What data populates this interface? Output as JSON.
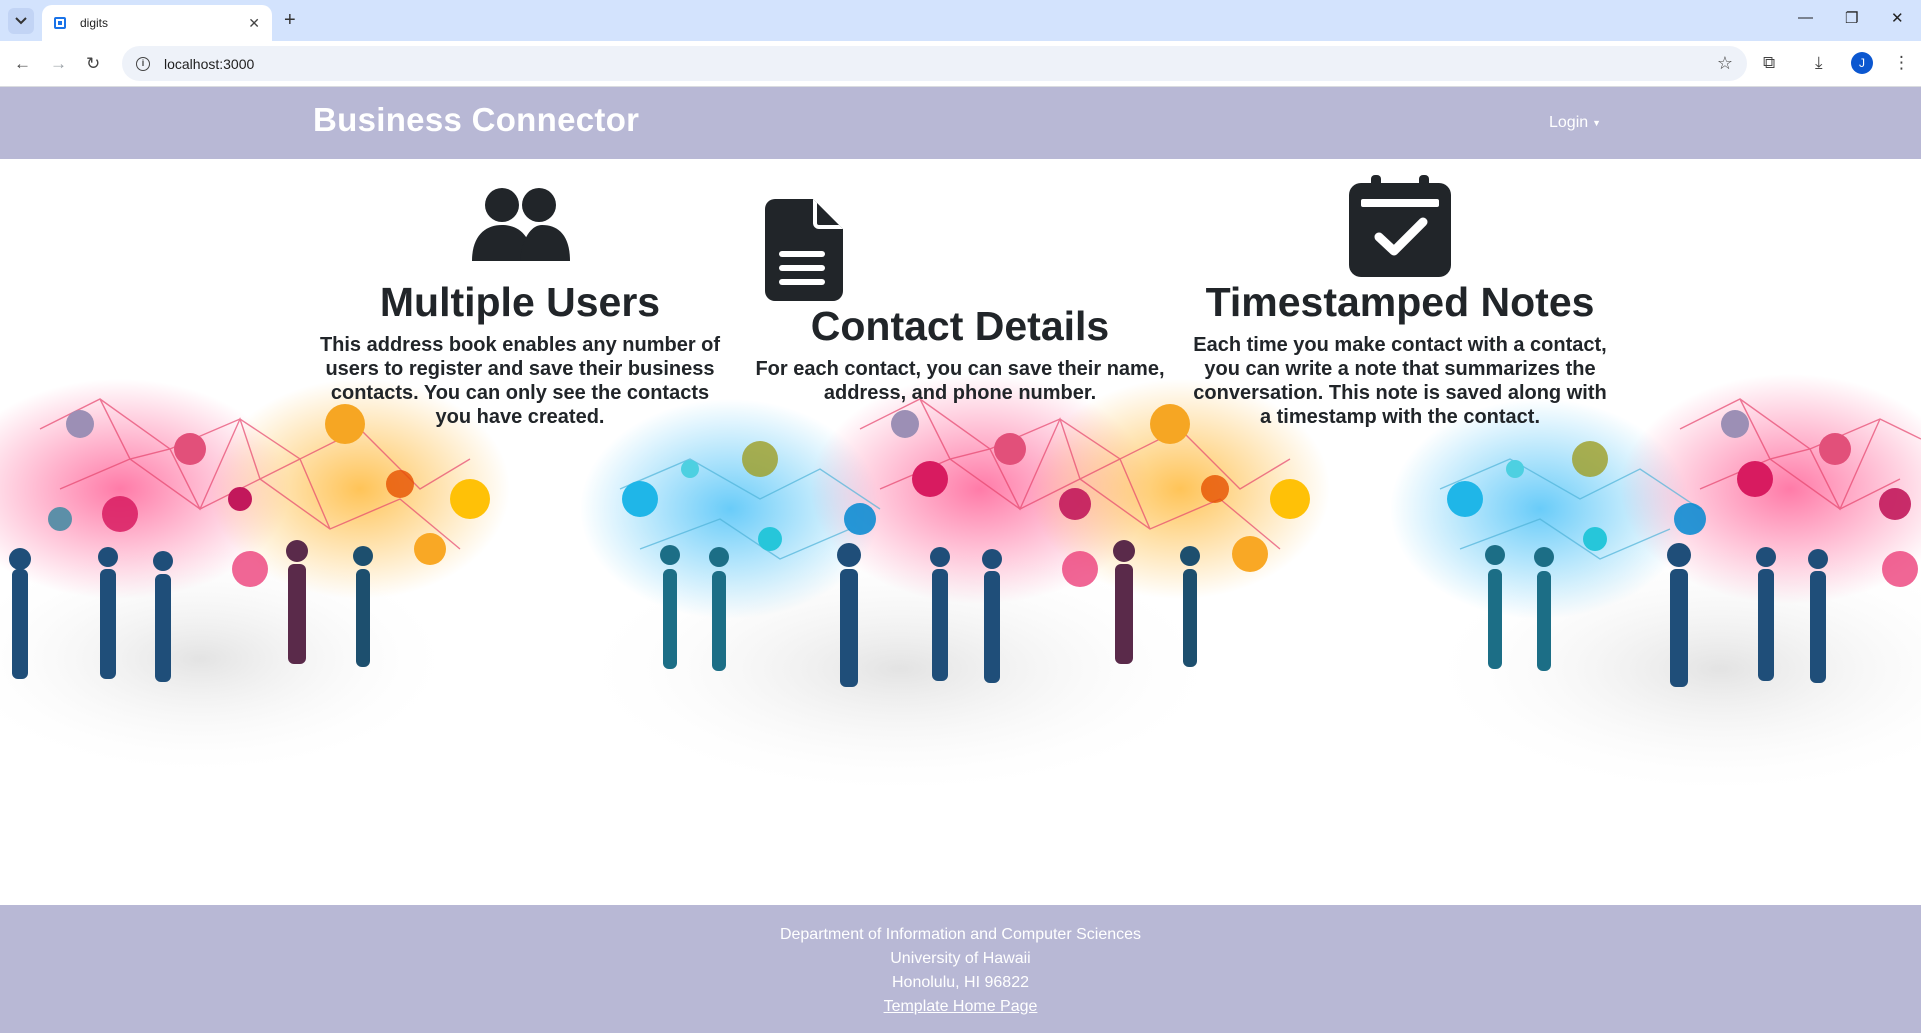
{
  "browser": {
    "tab_title": "digits",
    "url": "localhost:3000",
    "profile_initial": "J"
  },
  "navbar": {
    "brand": "Business Connector",
    "login_label": "Login"
  },
  "features": [
    {
      "icon": "users-icon",
      "title": "Multiple Users",
      "text": "This address book enables any number of users to register and save their business contacts. You can only see the contacts you have created."
    },
    {
      "icon": "document-icon",
      "title": "Contact Details",
      "text": "For each contact, you can save their name, address, and phone number."
    },
    {
      "icon": "calendar-check-icon",
      "title": "Timestamped Notes",
      "text": "Each time you make contact with a contact, you can write a note that summarizes the conversation. This note is saved along with a timestamp with the contact."
    }
  ],
  "footer": {
    "line1": "Department of Information and Computer Sciences",
    "line2": "University of Hawaii",
    "line3": "Honolulu, HI 96822",
    "link": "Template Home Page"
  },
  "colors": {
    "navbar_bg": "#b8b8d5",
    "footer_bg": "#b8b8d5",
    "text_dark": "#212529",
    "browser_tabbar": "#d3e3fd"
  }
}
